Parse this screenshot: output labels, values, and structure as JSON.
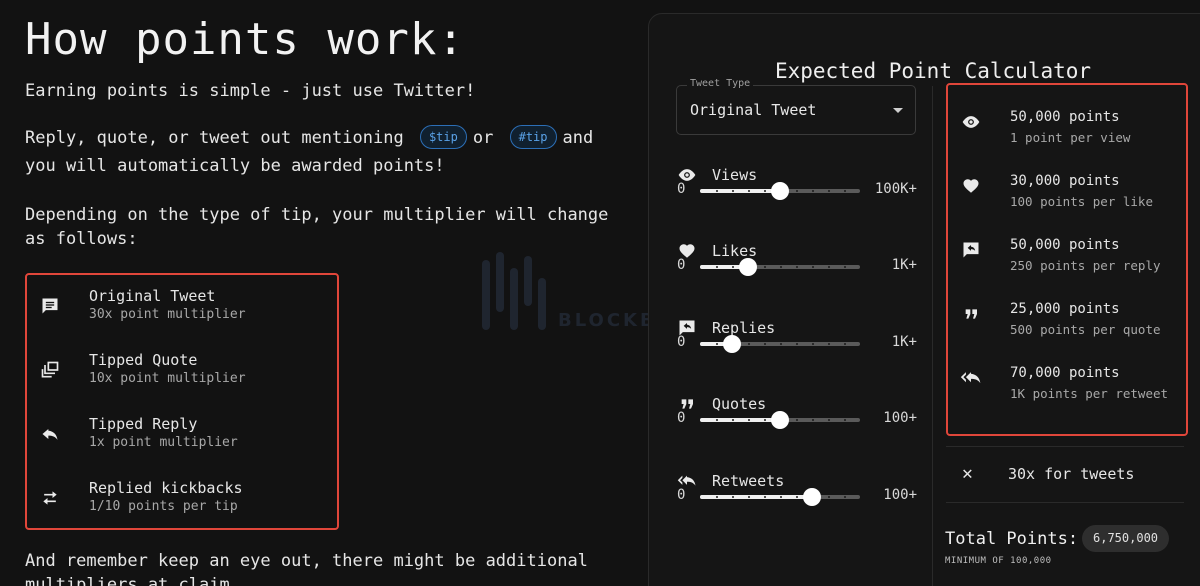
{
  "left": {
    "title": "How points work:",
    "intro": "Earning points is simple - just use Twitter!",
    "mention_prefix": "Reply, quote, or tweet out mentioning",
    "chip_dollar": "$tip",
    "or_word": "or",
    "chip_hash": "#tip",
    "and_word": "and",
    "mention_suffix": "you will automatically be awarded points!",
    "depend_line1": "Depending on the type of tip, your multiplier will change",
    "depend_line2": "as follows:",
    "multipliers": [
      {
        "title": "Original Tweet",
        "desc": "30x point multiplier",
        "icon": "message-icon"
      },
      {
        "title": "Tipped Quote",
        "desc": "10x point multiplier",
        "icon": "stacked-squares-icon"
      },
      {
        "title": "Tipped Reply",
        "desc": "1x point multiplier",
        "icon": "reply-arrow-icon"
      },
      {
        "title": "Replied kickbacks",
        "desc": "1/10 points per tip",
        "icon": "swap-arrows-icon"
      }
    ],
    "footer_line1": "And remember keep an eye out, there might be additional",
    "footer_line2": "multipliers at claim"
  },
  "calculator": {
    "title": "Expected Point Calculator",
    "tweet_type_label": "Tweet Type",
    "tweet_type_value": "Original Tweet",
    "sliders": [
      {
        "label": "Views",
        "min": "0",
        "max": "100K+",
        "value_fraction": 0.5,
        "icon": "eye-icon"
      },
      {
        "label": "Likes",
        "min": "0",
        "max": "1K+",
        "value_fraction": 0.3,
        "icon": "heart-icon"
      },
      {
        "label": "Replies",
        "min": "0",
        "max": "1K+",
        "value_fraction": 0.2,
        "icon": "reply-bubble-icon"
      },
      {
        "label": "Quotes",
        "min": "0",
        "max": "100+",
        "value_fraction": 0.5,
        "icon": "quote-icon"
      },
      {
        "label": "Retweets",
        "min": "0",
        "max": "100+",
        "value_fraction": 0.7,
        "icon": "reply-all-icon"
      }
    ],
    "breakdown": [
      {
        "points": "50,000 points",
        "desc": "1 point per view",
        "icon": "eye-icon"
      },
      {
        "points": "30,000 points",
        "desc": "100 points per like",
        "icon": "heart-icon"
      },
      {
        "points": "50,000 points",
        "desc": "250 points per reply",
        "icon": "reply-bubble-icon"
      },
      {
        "points": "25,000 points",
        "desc": "500 points per quote",
        "icon": "quote-icon"
      },
      {
        "points": "70,000 points",
        "desc": "1K points per retweet",
        "icon": "reply-all-icon"
      }
    ],
    "multiplier_symbol": "✕",
    "multiplier_text": "30x for tweets",
    "total_label": "Total Points:",
    "total_value": "6,750,000",
    "minimum_text": "MINIMUM OF 100,000"
  },
  "watermark": {
    "text": "BLOCKBEATS"
  },
  "colors": {
    "highlight_border": "#e0463a",
    "chip_blue": "#5aa2e8",
    "background": "#121212"
  }
}
